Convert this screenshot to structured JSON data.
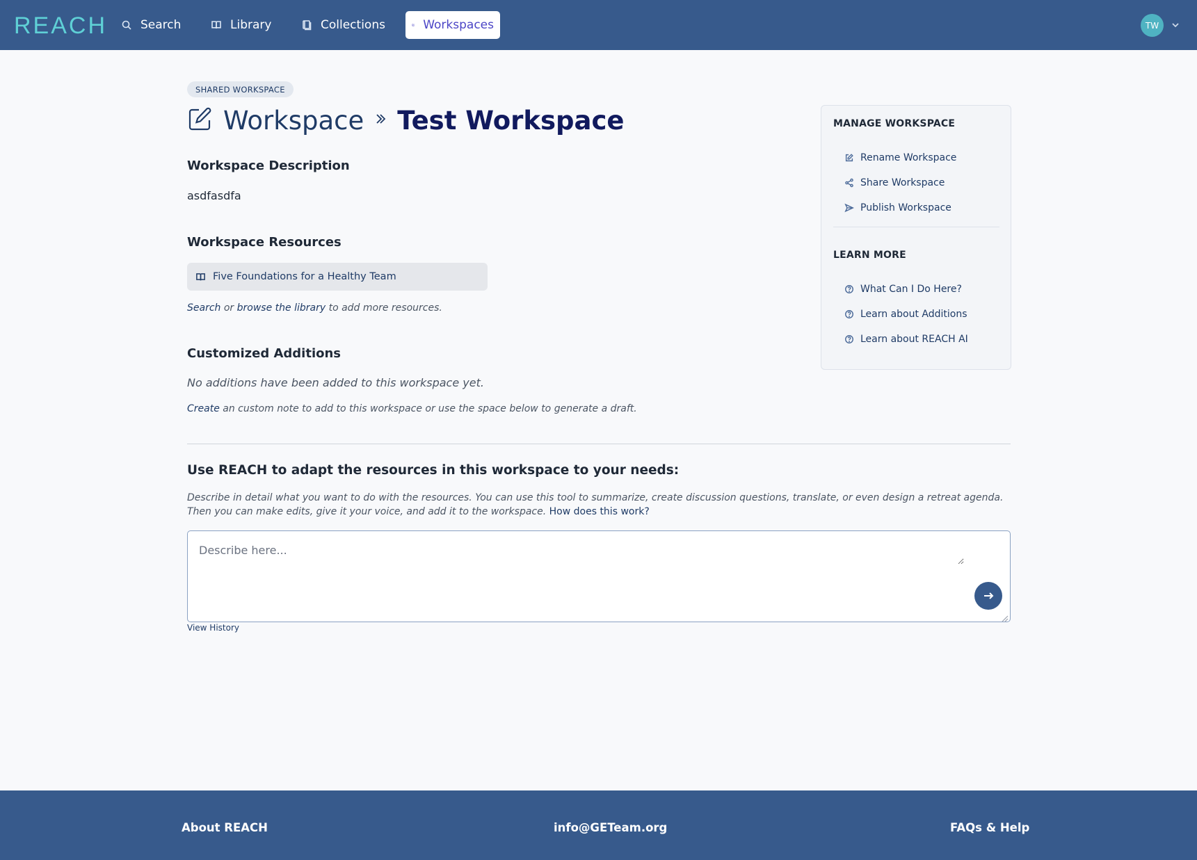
{
  "brand": {
    "logo": "REACH"
  },
  "nav": {
    "items": [
      {
        "label": "Search",
        "icon": "search-icon"
      },
      {
        "label": "Library",
        "icon": "book-icon"
      },
      {
        "label": "Collections",
        "icon": "collection-icon"
      },
      {
        "label": "Workspaces",
        "icon": "pencil-icon",
        "active": true
      }
    ],
    "user_initials": "TW"
  },
  "page": {
    "badge": "SHARED WORKSPACE",
    "breadcrumb": "Workspace",
    "title": "Test Workspace"
  },
  "description": {
    "heading": "Workspace Description",
    "text": "asdfasdfa"
  },
  "resources": {
    "heading": "Workspace Resources",
    "items": [
      {
        "label": "Five Foundations for a Healthy Team",
        "icon": "book-icon"
      }
    ],
    "hint": {
      "search_link": "Search",
      "or": " or ",
      "browse_link": "browse the library",
      "suffix": " to add more resources."
    }
  },
  "additions": {
    "heading": "Customized Additions",
    "empty": "No additions have been added to this workspace yet.",
    "hint": {
      "create_link": "Create",
      "suffix": " an custom note to add to this workspace or use the space below to generate a draft."
    }
  },
  "ai": {
    "heading": "Use REACH to adapt the resources in this workspace to your needs:",
    "description": "Describe in detail what you want to do with the resources. You can use this tool to summarize, create discussion questions, translate, or even design a retreat agenda. Then you can make edits, give it your voice, and add it to the workspace. ",
    "how_link": "How does this work?",
    "placeholder": "Describe here...",
    "value": "",
    "view_history": "View History"
  },
  "sidebar": {
    "manage_heading": "MANAGE WORKSPACE",
    "manage_items": [
      {
        "label": "Rename Workspace",
        "icon": "pencil-icon"
      },
      {
        "label": "Share Workspace",
        "icon": "share-icon"
      },
      {
        "label": "Publish Workspace",
        "icon": "send-icon"
      }
    ],
    "learn_heading": "LEARN MORE",
    "learn_items": [
      {
        "label": "What Can I Do Here?",
        "icon": "help-circle-icon"
      },
      {
        "label": "Learn about Additions",
        "icon": "help-circle-icon"
      },
      {
        "label": "Learn about REACH AI",
        "icon": "help-circle-icon"
      }
    ]
  },
  "footer": {
    "about": "About REACH",
    "email": "info@GETeam.org",
    "faq": "FAQs & Help"
  },
  "colors": {
    "header_bg": "#375a8c",
    "logo": "#5fd0d6",
    "active_nav_text": "#4b45c6",
    "title": "#111a5e",
    "link": "#1f3b66",
    "avatar": "#4fb3c2"
  }
}
